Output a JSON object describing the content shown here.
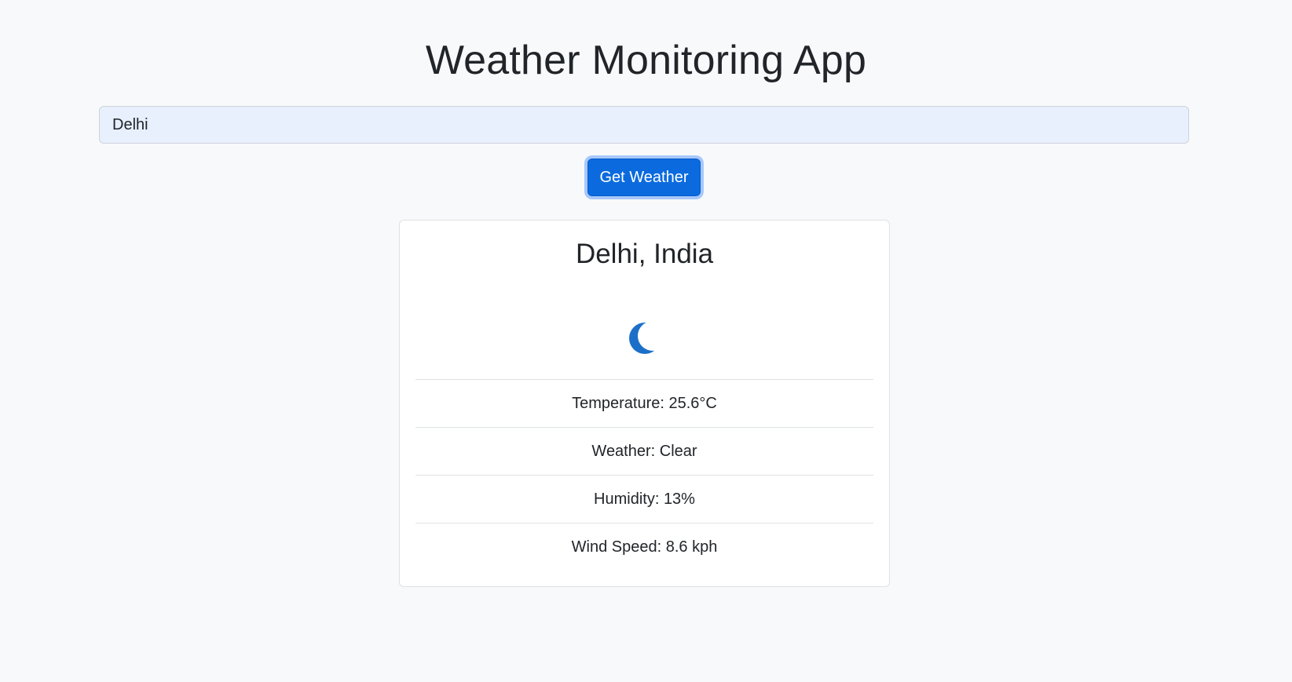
{
  "header": {
    "title": "Weather Monitoring App"
  },
  "search": {
    "value": "Delhi",
    "button_label": "Get Weather"
  },
  "weather": {
    "location": "Delhi, India",
    "icon": "crescent-moon-icon",
    "details": {
      "temperature": "Temperature: 25.6°C",
      "condition": "Weather: Clear",
      "humidity": "Humidity: 13%",
      "wind_speed": "Wind Speed: 8.6 kph"
    }
  },
  "colors": {
    "background": "#f8f9fa",
    "accent": "#0b6bde",
    "input_fill": "#e8f0fe",
    "card_border": "#dee2e6",
    "text": "#212529"
  }
}
